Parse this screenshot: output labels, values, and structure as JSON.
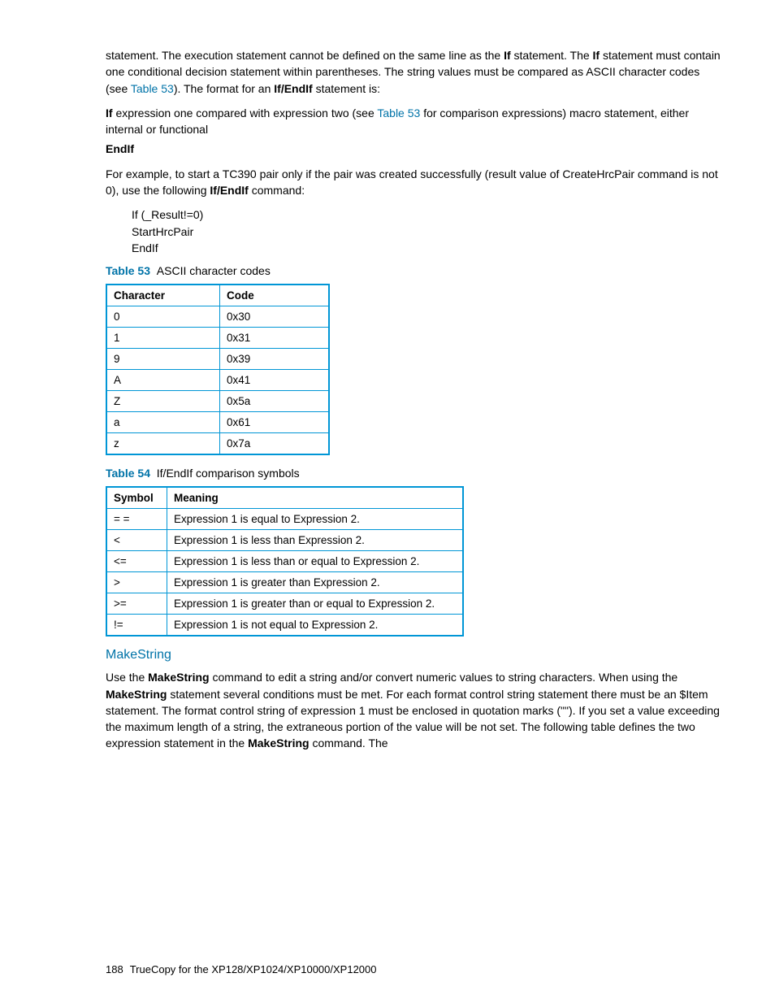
{
  "para1": {
    "t1": "statement. The execution statement cannot be defined on the same line as the ",
    "b1": "If",
    "t2": " statement. The ",
    "b2": "If",
    "t3": " statement must contain one conditional decision statement within parentheses. The string values must be compared as ASCII character codes (see ",
    "l1": "Table 53",
    "t4": "). The format for an ",
    "b3": "If/EndIf",
    "t5": " statement is:"
  },
  "para2": {
    "b1": "If",
    "t1": " expression one compared with expression two (see ",
    "l1": "Table 53",
    "t2": " for comparison expressions) macro statement, either internal or functional",
    "b2": "EndIf"
  },
  "para3": {
    "t1": "For example, to start a TC390 pair only if the pair was created successfully (result value of CreateHrcPair command is not 0), use the following ",
    "b1": "If/EndIf",
    "t2": " command:"
  },
  "code": {
    "l1": "If (_Result!=0)",
    "l2": "StartHrcPair",
    "l3": "EndIf"
  },
  "t53": {
    "label": "Table 53",
    "title": "ASCII character codes",
    "headers": [
      "Character",
      "Code"
    ],
    "rows": [
      [
        "0",
        "0x30"
      ],
      [
        "1",
        "0x31"
      ],
      [
        "9",
        "0x39"
      ],
      [
        "A",
        "0x41"
      ],
      [
        "Z",
        "0x5a"
      ],
      [
        "a",
        "0x61"
      ],
      [
        "z",
        "0x7a"
      ]
    ]
  },
  "t54": {
    "label": "Table 54",
    "title": "If/EndIf comparison symbols",
    "headers": [
      "Symbol",
      "Meaning"
    ],
    "rows": [
      [
        "= =",
        "Expression 1 is equal to Expression 2."
      ],
      [
        "<",
        "Expression 1 is less than Expression 2."
      ],
      [
        "<=",
        "Expression 1 is less than or equal to Expression 2."
      ],
      [
        ">",
        "Expression 1 is greater than Expression 2."
      ],
      [
        ">=",
        "Expression 1 is greater than or equal to Expression 2."
      ],
      [
        "!=",
        "Expression 1 is not equal to Expression 2."
      ]
    ]
  },
  "section": {
    "heading": "MakeString",
    "t1": "Use the ",
    "b1": "MakeString",
    "t2": " command to edit a string and/or convert numeric values to string characters. When using the ",
    "b2": "MakeString",
    "t3": " statement several conditions must be met. For each format control string statement there must be an $Item statement. The format control string of expression 1 must be enclosed in quotation marks (\"\"). If you set a value exceeding the maximum length of a string, the extraneous portion of the value will be not set. The following table defines the two expression statement in the ",
    "b3": "MakeString",
    "t4": " command. The"
  },
  "footer": {
    "page": "188",
    "text": "TrueCopy for the XP128/XP1024/XP10000/XP12000"
  }
}
